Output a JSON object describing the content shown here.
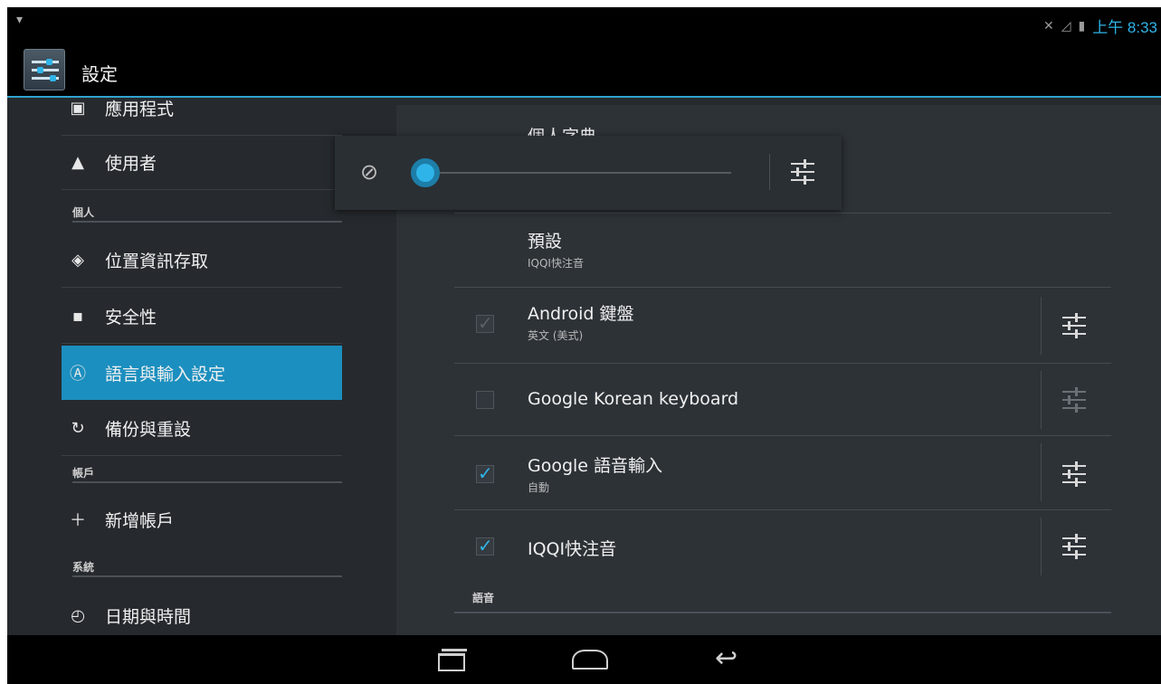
{
  "status_bar": {
    "left_icon": "wifi-icon",
    "right_icons": [
      "mute-icon",
      "signal-icon",
      "battery-icon"
    ],
    "time": "上午 8:33"
  },
  "action_bar": {
    "app_icon": "settings-app-icon",
    "title": "設定"
  },
  "left_nav": {
    "items": [
      {
        "name": "apps",
        "label": "應用程式",
        "icon": "apps-icon"
      },
      {
        "name": "users",
        "label": "使用者",
        "icon": "user-icon"
      },
      {
        "name": "location",
        "label": "位置資訊存取",
        "icon": "location-icon"
      },
      {
        "name": "security",
        "label": "安全性",
        "icon": "lock-icon"
      },
      {
        "name": "language",
        "label": "語言與輸入設定",
        "icon": "keyboard-letter-icon"
      },
      {
        "name": "backup",
        "label": "備份與重設",
        "icon": "restore-icon"
      },
      {
        "name": "add-account",
        "label": "新增帳戶",
        "icon": "plus-icon"
      },
      {
        "name": "datetime",
        "label": "日期與時間",
        "icon": "clock-icon"
      }
    ],
    "headers": {
      "personal": "個人",
      "accounts": "帳戶",
      "system": "系統"
    },
    "selected": "語言與輸入設定"
  },
  "detail": {
    "personal_dictionary": "個人字典",
    "default": {
      "title": "預設",
      "subtitle": "IQQI快注音"
    },
    "keyboards": [
      {
        "title": "Android 鍵盤",
        "subtitle": "英文 (美式)",
        "checked": true,
        "enabled": false
      },
      {
        "title": "Google Korean keyboard",
        "subtitle": "",
        "checked": false,
        "enabled": true
      },
      {
        "title": "Google 語音輸入",
        "subtitle": "自動",
        "checked": true,
        "enabled": true
      },
      {
        "title": "IQQI快注音",
        "subtitle": "",
        "checked": true,
        "enabled": true
      }
    ],
    "section_voice": "語音"
  },
  "volume_popup": {
    "mute_icon": "volume-mute-icon",
    "level": 0.0,
    "settings_icon": "tune-icon"
  },
  "nav_bar": {
    "buttons": [
      "recent-apps-icon",
      "home-icon",
      "back-icon"
    ]
  },
  "colors": {
    "accent": "#2fb4e9",
    "selected_bg": "#1b8fbf",
    "background": "#262a2e"
  }
}
